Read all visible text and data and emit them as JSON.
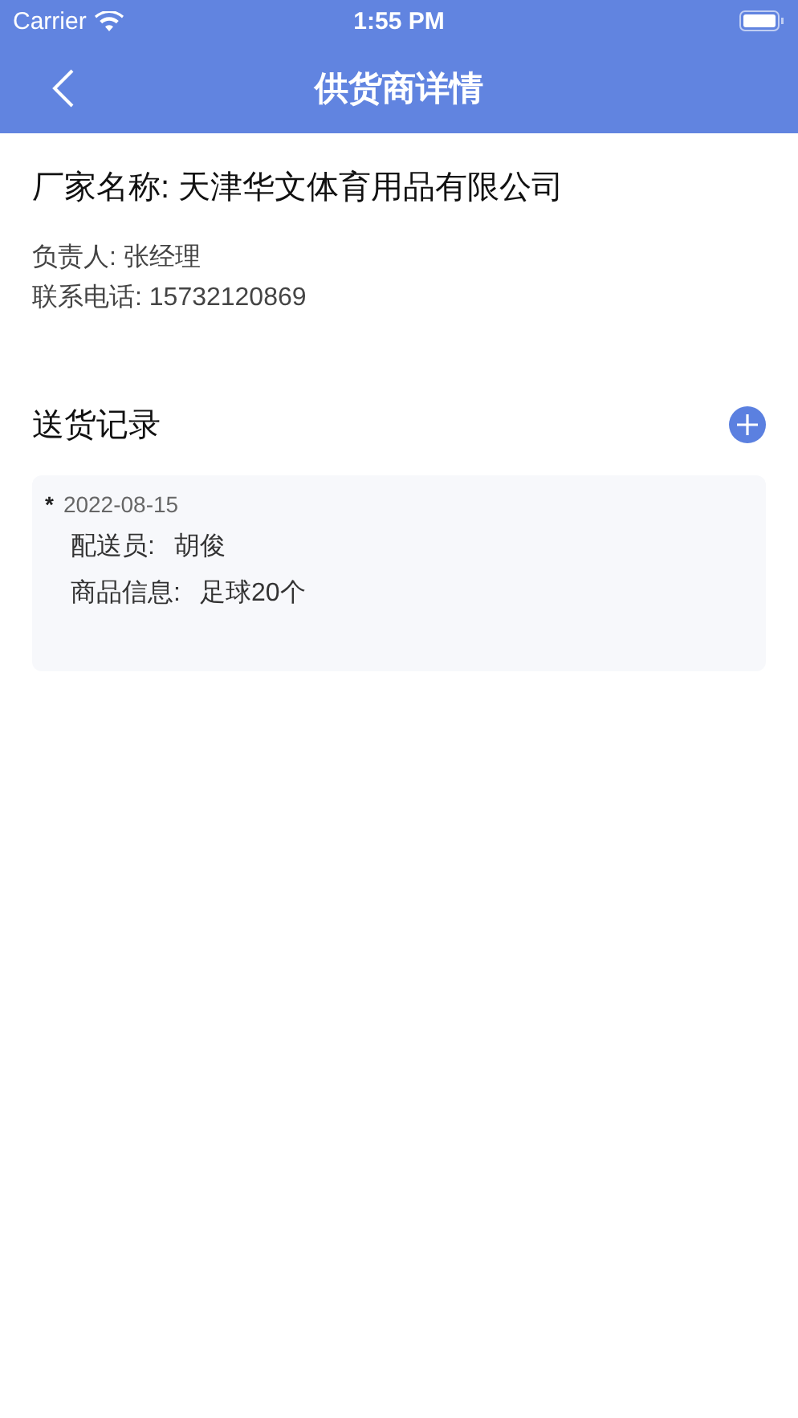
{
  "status_bar": {
    "carrier": "Carrier",
    "time": "1:55 PM"
  },
  "nav_bar": {
    "title": "供货商详情"
  },
  "supplier": {
    "name": "厂家名称: 天津华文体育用品有限公司",
    "contact": "负责人: 张经理",
    "phone": "联系电话: 15732120869"
  },
  "deliveries": {
    "title": "送货记录",
    "records": [
      {
        "bullet": "*",
        "date": "2022-08-15",
        "fields": [
          {
            "label": "配送员:",
            "value": "胡俊"
          },
          {
            "label": "商品信息:",
            "value": "足球20个"
          }
        ]
      }
    ]
  }
}
